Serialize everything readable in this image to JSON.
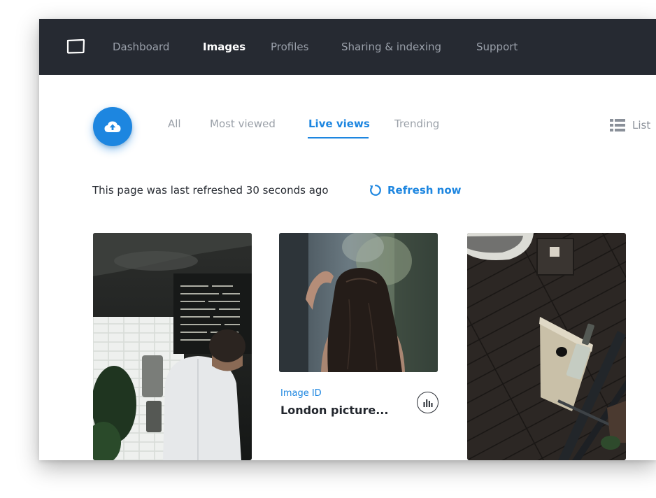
{
  "nav": {
    "items": [
      {
        "label": "Dashboard",
        "active": false
      },
      {
        "label": "Images",
        "active": true
      },
      {
        "label": "Profiles",
        "active": false
      },
      {
        "label": "Sharing & indexing",
        "active": false
      },
      {
        "label": "Support",
        "active": false
      }
    ]
  },
  "tabs": [
    {
      "label": "All",
      "active": false
    },
    {
      "label": "Most viewed",
      "active": false
    },
    {
      "label": "Live views",
      "active": true
    },
    {
      "label": "Trending",
      "active": false
    }
  ],
  "view_toggle": {
    "label": "List",
    "icon": "list-icon"
  },
  "refresh": {
    "status": "This page was last refreshed 30 seconds ago",
    "action": "Refresh now",
    "icon": "refresh-icon"
  },
  "cards": [
    {
      "image": "cafe-barista-photo"
    },
    {
      "image": "woman-hair-photo",
      "id_label": "Image ID",
      "title": "London picture...",
      "action_icon": "bar-chart-icon"
    },
    {
      "image": "overhead-desk-photo"
    }
  ],
  "colors": {
    "accent": "#1d86e0",
    "nav_background": "#262a32",
    "text_dark": "#22262d",
    "text_muted": "#9aa0a8"
  }
}
